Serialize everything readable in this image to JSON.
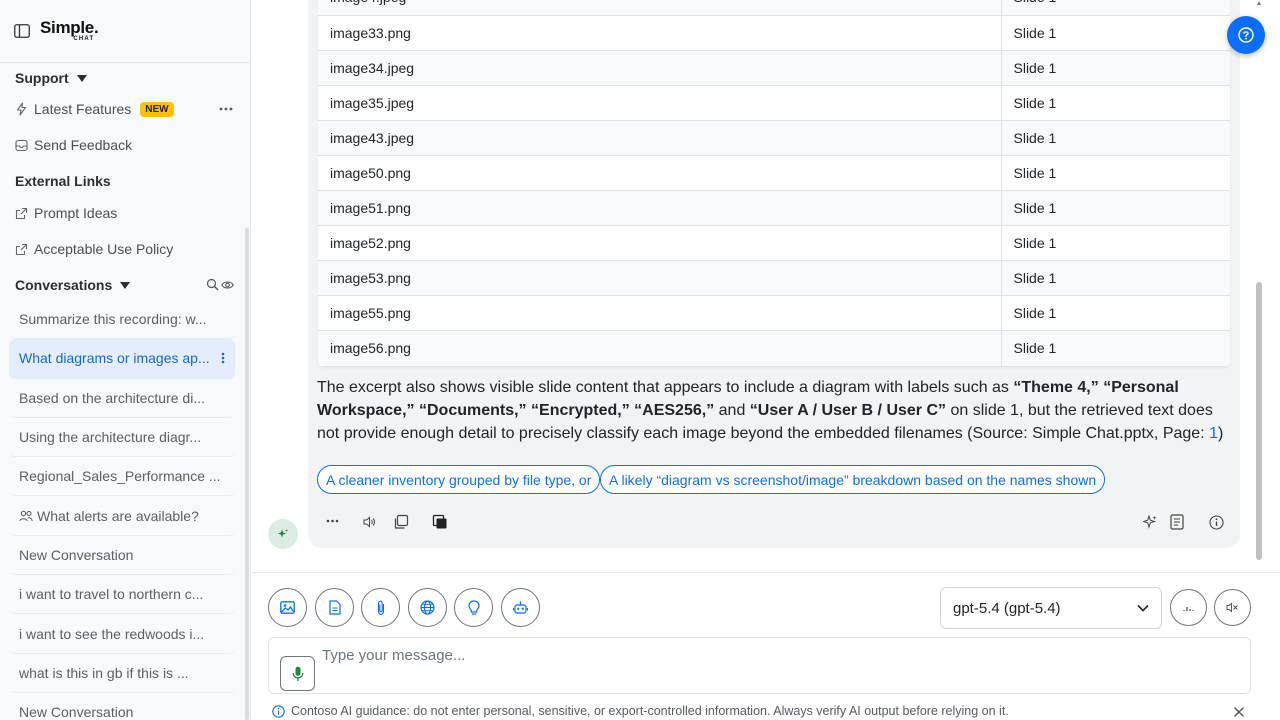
{
  "app": {
    "logo_main": "Simple.",
    "logo_sub": "CHAT"
  },
  "sidebar": {
    "support_heading": "Support",
    "latest_features": "Latest Features",
    "new_badge": "NEW",
    "send_feedback": "Send Feedback",
    "external_links_heading": "External Links",
    "prompt_ideas": "Prompt Ideas",
    "acceptable_use": "Acceptable Use Policy",
    "conversations_heading": "Conversations",
    "conversations": [
      {
        "title": "Summarize this recording: w..."
      },
      {
        "title": "What diagrams or images ap..."
      },
      {
        "title": "Based on the architecture di..."
      },
      {
        "title": "Using the architecture diagr..."
      },
      {
        "title": "Regional_Sales_Performance ..."
      },
      {
        "title": "What alerts are available?"
      },
      {
        "title": "New Conversation"
      },
      {
        "title": "i want to travel to northern c..."
      },
      {
        "title": "i want to see the redwoods i..."
      },
      {
        "title": "what is this in gb if this is ..."
      },
      {
        "title": "New Conversation"
      }
    ]
  },
  "chat": {
    "table_rows": [
      {
        "file": "image33.png",
        "slide": "Slide 1"
      },
      {
        "file": "image34.jpeg",
        "slide": "Slide 1"
      },
      {
        "file": "image35.jpeg",
        "slide": "Slide 1"
      },
      {
        "file": "image43.jpeg",
        "slide": "Slide 1"
      },
      {
        "file": "image50.png",
        "slide": "Slide 1"
      },
      {
        "file": "image51.png",
        "slide": "Slide 1"
      },
      {
        "file": "image52.png",
        "slide": "Slide 1"
      },
      {
        "file": "image53.png",
        "slide": "Slide 1"
      },
      {
        "file": "image55.png",
        "slide": "Slide 1"
      },
      {
        "file": "image56.png",
        "slide": "Slide 1"
      }
    ],
    "para": {
      "t1": "The excerpt also shows visible slide content that appears to include a diagram with labels such as ",
      "b1": "“Theme 4,”",
      "b2": "“Personal Workspace,”",
      "b3": "“Documents,”",
      "b4": "“Encrypted,”",
      "b5": "“AES256,”",
      "t2": " and ",
      "b6": "“User A / User B / User C”",
      "t3": " on slide 1, but the retrieved text does not provide enough detail to precisely classify each image beyond the embedded filenames (Source: Simple Chat.pptx, Page: ",
      "link": "1",
      "t4": ")"
    },
    "suggestions": [
      "A cleaner inventory grouped by file type, or",
      "A likely “diagram vs screenshot/image” breakdown based on the names shown"
    ]
  },
  "composer": {
    "model_select": "gpt-5.4 (gpt-5.4)",
    "placeholder": "Type your message..."
  },
  "notice": "Contoso AI guidance: do not enter personal, sensitive, or export-controlled information. Always verify AI output before relying on it.",
  "colors": {
    "accent": "#0d6efd",
    "active_conv_bg": "#e3edfb",
    "badge": "#ffc107",
    "bubble_bg": "#f1f3f5"
  }
}
